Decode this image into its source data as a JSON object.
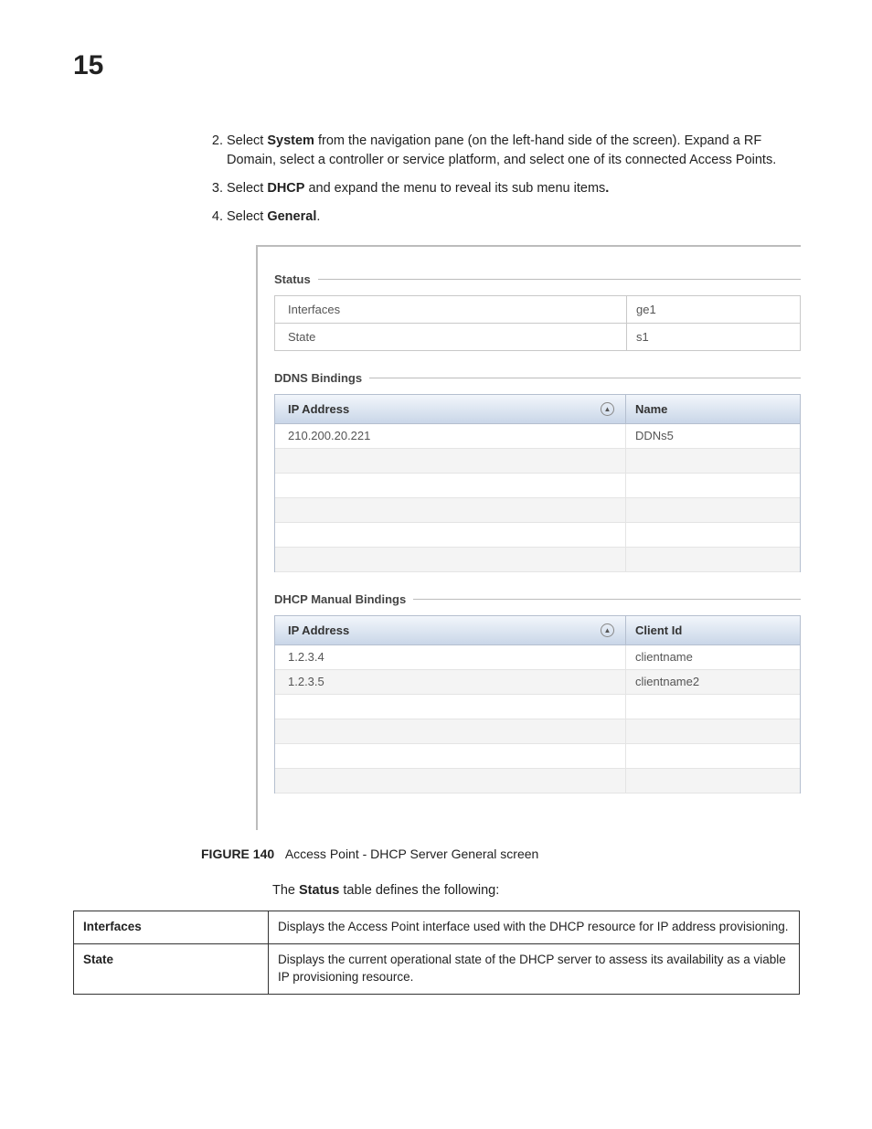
{
  "chapter": "15",
  "steps": {
    "s2a": "Select ",
    "s2b": "System",
    "s2c": " from the navigation pane (on the left-hand side of the screen). Expand a RF Domain, select a controller or service platform, and select one of its connected Access Points.",
    "s3a": "Select ",
    "s3b": "DHCP",
    "s3c": " and expand the menu to reveal its sub menu items",
    "s3d": ".",
    "s4a": "Select ",
    "s4b": "General",
    "s4c": "."
  },
  "panel": {
    "status_title": "Status",
    "status_rows": [
      {
        "label": "Interfaces",
        "value": "ge1"
      },
      {
        "label": "State",
        "value": "s1"
      }
    ],
    "ddns_title": "DDNS Bindings",
    "ddns_headers": {
      "col1": "IP Address",
      "col2": "Name"
    },
    "ddns_rows": [
      {
        "c1": "210.200.20.221",
        "c2": "DDNs5"
      },
      {
        "c1": "",
        "c2": ""
      },
      {
        "c1": "",
        "c2": ""
      },
      {
        "c1": "",
        "c2": ""
      },
      {
        "c1": "",
        "c2": ""
      },
      {
        "c1": "",
        "c2": ""
      }
    ],
    "manual_title": "DHCP Manual Bindings",
    "manual_headers": {
      "col1": "IP Address",
      "col2": "Client Id"
    },
    "manual_rows": [
      {
        "c1": "1.2.3.4",
        "c2": "clientname"
      },
      {
        "c1": "1.2.3.5",
        "c2": "clientname2"
      },
      {
        "c1": "",
        "c2": ""
      },
      {
        "c1": "",
        "c2": ""
      },
      {
        "c1": "",
        "c2": ""
      },
      {
        "c1": "",
        "c2": ""
      }
    ]
  },
  "figure": {
    "num": "FIGURE 140",
    "caption": "Access Point - DHCP Server General screen"
  },
  "para": {
    "a": "The ",
    "b": "Status",
    "c": " table defines the following:"
  },
  "def_rows": [
    {
      "term": "Interfaces",
      "desc": "Displays the Access Point interface used with the DHCP resource for IP address provisioning."
    },
    {
      "term": "State",
      "desc": "Displays the current operational state of the DHCP server to assess its availability as a viable IP provisioning resource."
    }
  ]
}
